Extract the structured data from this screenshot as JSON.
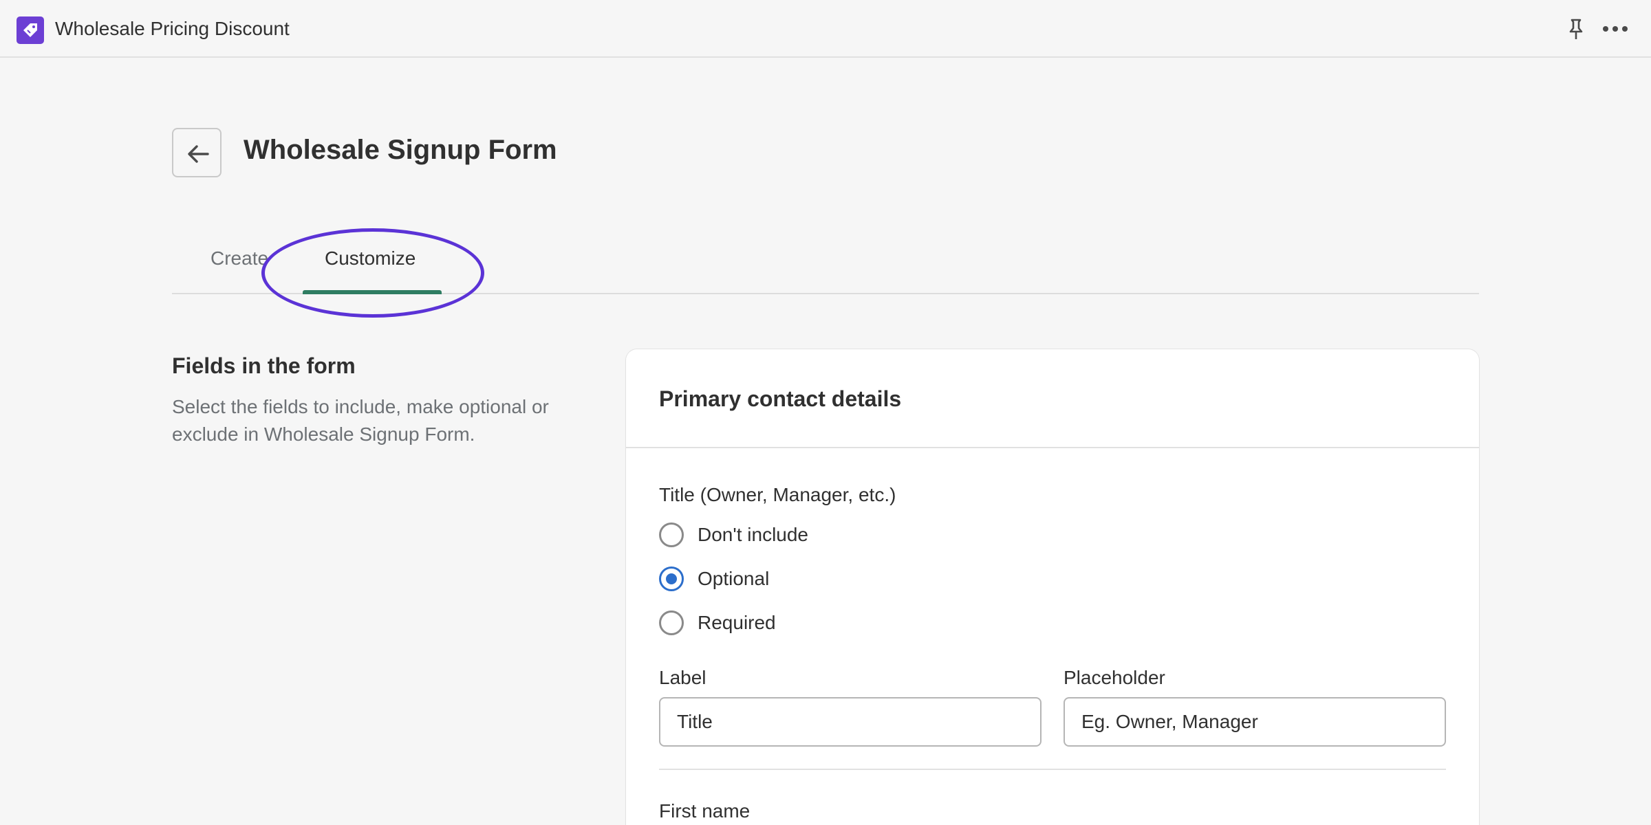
{
  "app": {
    "title": "Wholesale Pricing Discount",
    "icon": "tag-icon",
    "brand_color": "#6c3fd4"
  },
  "topbar_actions": [
    "pin-icon",
    "more-horizontal-icon"
  ],
  "page": {
    "title": "Wholesale Signup Form",
    "back_icon": "arrow-left-icon"
  },
  "tabs": [
    {
      "label": "Create",
      "selected": false
    },
    {
      "label": "Customize",
      "selected": true
    }
  ],
  "annotation": {
    "shape": "ellipse",
    "color": "#5b33d6",
    "target": "Customize tab"
  },
  "section": {
    "heading": "Fields in the form",
    "description": "Select the fields to include, make optional or exclude in Wholesale Signup Form."
  },
  "card": {
    "title": "Primary contact details",
    "fields": [
      {
        "name": "Title (Owner, Manager, etc.)",
        "options": [
          {
            "label": "Don't include",
            "checked": false
          },
          {
            "label": "Optional",
            "checked": true
          },
          {
            "label": "Required",
            "checked": false
          }
        ],
        "label_field": {
          "label": "Label",
          "value": "Title"
        },
        "placeholder_field": {
          "label": "Placeholder",
          "value": "Eg. Owner, Manager"
        }
      },
      {
        "name": "First name"
      }
    ]
  },
  "colors": {
    "accent_blue": "#2c6ecb",
    "tab_underline_green": "#2f7d62",
    "background": "#f6f6f6"
  }
}
